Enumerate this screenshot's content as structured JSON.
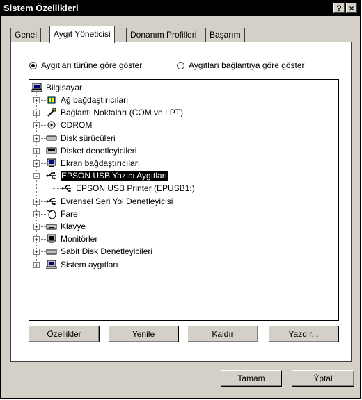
{
  "window": {
    "title": "Sistem Özellikleri",
    "help_btn": "?",
    "close_btn": "×"
  },
  "tabs": [
    {
      "label": "Genel"
    },
    {
      "label": "Aygıt Yöneticisi"
    },
    {
      "label": "Donanım Profilleri"
    },
    {
      "label": "Başarım"
    }
  ],
  "view_options": {
    "by_type": "Aygıtları türüne göre göster",
    "by_connection": "Aygıtları bağlantıya göre göster",
    "selected": "by_type"
  },
  "tree": {
    "root": "Bilgisayar",
    "items": [
      {
        "label": "Ağ bağdaştırıcıları",
        "icon": "network-adapter-icon"
      },
      {
        "label": "Bağlantı Noktaları (COM ve LPT)",
        "icon": "port-icon"
      },
      {
        "label": "CDROM",
        "icon": "cdrom-icon"
      },
      {
        "label": "Disk sürücüleri",
        "icon": "disk-drive-icon"
      },
      {
        "label": "Disket denetleyicileri",
        "icon": "floppy-controller-icon"
      },
      {
        "label": "Ekran bağdaştırıcıları",
        "icon": "display-adapter-icon"
      },
      {
        "label": "EPSON USB Yazıcı Aygıtları",
        "icon": "usb-icon",
        "expanded": true,
        "selected": true
      },
      {
        "label": "EPSON USB Printer (EPUSB1:)",
        "icon": "usb-icon",
        "child": true
      },
      {
        "label": "Evrensel Seri Yol Denetleyicisi",
        "icon": "usb-icon"
      },
      {
        "label": "Fare",
        "icon": "mouse-icon"
      },
      {
        "label": "Klavye",
        "icon": "keyboard-icon"
      },
      {
        "label": "Monitörler",
        "icon": "monitor-icon"
      },
      {
        "label": "Sabit Disk Denetleyicileri",
        "icon": "hard-disk-controller-icon"
      },
      {
        "label": "Sistem aygıtları",
        "icon": "system-device-icon"
      }
    ]
  },
  "buttons": {
    "properties": "Özellikler",
    "refresh": "Yenile",
    "remove": "Kaldır",
    "print": "Yazdır...",
    "ok": "Tamam",
    "cancel": "Ýptal"
  }
}
